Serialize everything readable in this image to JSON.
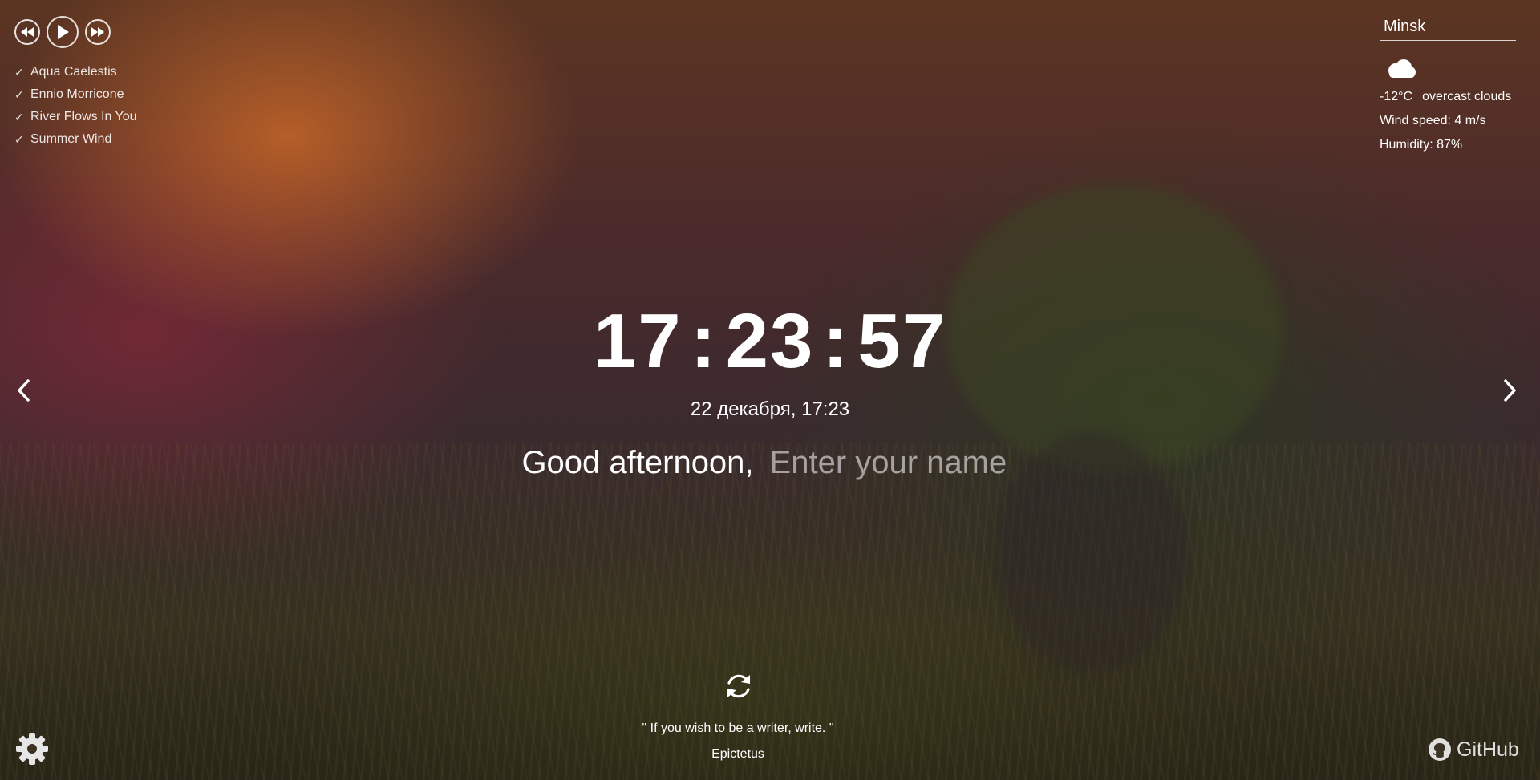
{
  "player": {
    "playlist": [
      {
        "check": "✓",
        "title": "Aqua Caelestis"
      },
      {
        "check": "✓",
        "title": "Ennio Morricone"
      },
      {
        "check": "✓",
        "title": "River Flows In You"
      },
      {
        "check": "✓",
        "title": "Summer Wind"
      }
    ],
    "icons": {
      "prev": "rewind-icon",
      "play": "play-icon",
      "next": "fast-forward-icon"
    }
  },
  "weather": {
    "city": "Minsk",
    "icon": "cloud-icon",
    "temperature": "-12°C",
    "description": "overcast clouds",
    "wind": "Wind speed: 4 m/s",
    "humidity": "Humidity: 87%"
  },
  "clock": {
    "hours": "17",
    "minutes": "23",
    "seconds": "57",
    "separator": ":",
    "date": "22 декабря, 17:23"
  },
  "greeting": {
    "text": "Good afternoon,",
    "name_placeholder": "Enter your name"
  },
  "slider": {
    "prev_icon": "chevron-left-icon",
    "next_icon": "chevron-right-icon"
  },
  "quote": {
    "refresh_icon": "refresh-icon",
    "text": "\" If you wish to be a writer, write. \"",
    "author": "Epictetus"
  },
  "footer": {
    "settings_icon": "gear-icon",
    "github_label": "GitHub",
    "github_icon": "github-icon"
  },
  "colors": {
    "text": "#ffffff",
    "placeholder": "rgba(255,255,255,0.55)"
  }
}
